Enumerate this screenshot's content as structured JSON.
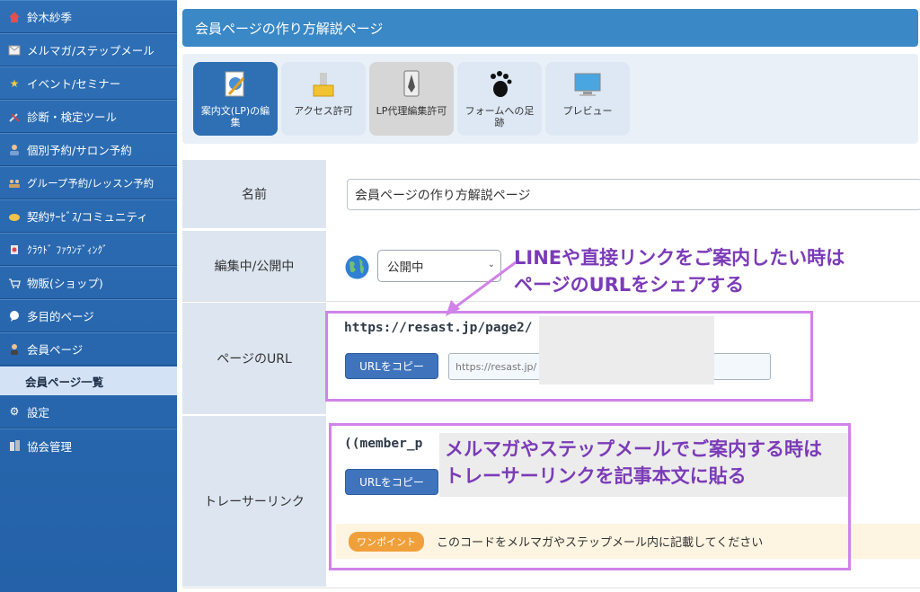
{
  "sidebar": {
    "items": [
      {
        "label": "鈴木紗季",
        "icon": "home-icon"
      },
      {
        "label": "メルマガ/ステップメール",
        "icon": "mail-icon"
      },
      {
        "label": "イベント/セミナー",
        "icon": "star-icon"
      },
      {
        "label": "診断・検定ツール",
        "icon": "tools-icon"
      },
      {
        "label": "個別予約/サロン予約",
        "icon": "person-icon"
      },
      {
        "label": "グループ予約/レッスン予約",
        "icon": "group-icon"
      },
      {
        "label": "契約ｻｰﾋﾞｽ/コミュニティ",
        "icon": "contract-icon"
      },
      {
        "label": "ｸﾗｳﾄﾞ ﾌｧｳﾝﾃﾞｨﾝｸﾞ",
        "icon": "crowdfunding-icon"
      },
      {
        "label": "物販(ショップ)",
        "icon": "cart-icon"
      },
      {
        "label": "多目的ページ",
        "icon": "bubble-icon"
      },
      {
        "label": "会員ページ",
        "icon": "member-icon"
      }
    ],
    "sub_item": "会員ページ一覧",
    "bottom_items": [
      {
        "label": "設定",
        "icon": "gear-icon"
      },
      {
        "label": "協会管理",
        "icon": "building-icon"
      }
    ]
  },
  "header": {
    "title": "会員ページの作り方解説ページ"
  },
  "toolbar": {
    "buttons": [
      {
        "label": "案内文(LP)の編集",
        "icon": "edit-document-icon",
        "active": true
      },
      {
        "label": "アクセス許可",
        "icon": "lock-icon",
        "active": false
      },
      {
        "label": "LP代理編集許可",
        "icon": "pen-icon",
        "active": false
      },
      {
        "label": "フォームへの足跡",
        "icon": "footprint-icon",
        "active": false
      },
      {
        "label": "プレビュー",
        "icon": "monitor-icon",
        "active": false
      }
    ]
  },
  "form": {
    "name_label": "名前",
    "name_value": "会員ページの作り方解説ページ",
    "status_label": "編集中/公開中",
    "status_value": "公開中",
    "url_label": "ページのURL",
    "url_text": "https://resast.jp/page2/",
    "url_input_value": "https://resast.jp/",
    "copy_label": "URLをコピー",
    "tracer_label": "トレーサーリンク",
    "tracer_text": "((member_p",
    "tracer_copy_label": "URLをコピー",
    "onepoint_badge": "ワンポイント",
    "onepoint_text": "このコードをメルマガやステップメール内に記載してください"
  },
  "annotations": {
    "callout1_line1": "LINEや直接リンクをご案内したい時は",
    "callout1_line2": "ページのURLをシェアする",
    "callout2_line1": "メルマガやステップメールでご案内する時は",
    "callout2_line2": "トレーサーリンクを記事本文に貼る",
    "color": "#d083e8",
    "text_color": "#7b3bb8"
  },
  "colors": {
    "sidebar": "#2e6fb5",
    "header": "#3a88c6",
    "button": "#3f74bd",
    "badge": "#f0a03a"
  }
}
